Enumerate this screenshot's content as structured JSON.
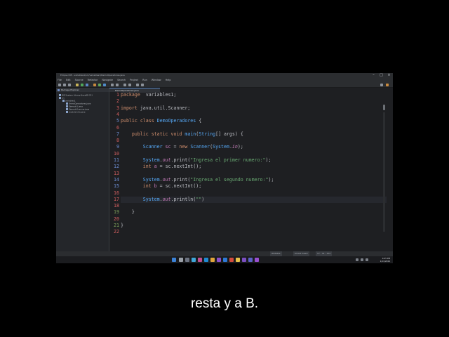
{
  "window": {
    "title": "Eclipse IDE - variables1/src/variables1/DemoOperadores.java",
    "menu": [
      "File",
      "Edit",
      "Source",
      "Refactor",
      "Navigate",
      "Search",
      "Project",
      "Run",
      "Window",
      "Help"
    ]
  },
  "explorer": {
    "tab_label": "Package Explorer",
    "items": [
      "JRE System Library [JavaSE-21]",
      "src",
      "variables1",
      "DemoOperadores.java",
      "Ejemplo1.java",
      "EjemploScanner.java",
      "module-info.java"
    ]
  },
  "editor": {
    "tab_label": "DemoOperadores.java",
    "lines": [
      {
        "n": "1",
        "tokens": [
          [
            "kw",
            "package"
          ],
          [
            "",
            "  variables1;"
          ]
        ]
      },
      {
        "n": "2",
        "tokens": []
      },
      {
        "n": "3",
        "tokens": [
          [
            "kw",
            "import"
          ],
          [
            "",
            " java.util.Scanner;"
          ]
        ]
      },
      {
        "n": "4",
        "tokens": []
      },
      {
        "n": "5",
        "tokens": [
          [
            "kw",
            "public"
          ],
          [
            "",
            " "
          ],
          [
            "kw",
            "class"
          ],
          [
            "",
            " "
          ],
          [
            "cls",
            "DemoOperadores"
          ],
          [
            "",
            " {"
          ]
        ]
      },
      {
        "n": "6",
        "tokens": []
      },
      {
        "n": "7",
        "tokens": [
          [
            "",
            "    "
          ],
          [
            "kw",
            "public"
          ],
          [
            "",
            " "
          ],
          [
            "kw",
            "static"
          ],
          [
            "",
            " "
          ],
          [
            "kw",
            "void"
          ],
          [
            "",
            " "
          ],
          [
            "cls",
            "main"
          ],
          [
            "",
            "("
          ],
          [
            "cls",
            "String"
          ],
          [
            "",
            "[] args) {"
          ]
        ]
      },
      {
        "n": "8",
        "tokens": []
      },
      {
        "n": "9",
        "tokens": [
          [
            "",
            "        "
          ],
          [
            "cls",
            "Scanner"
          ],
          [
            "",
            " "
          ],
          [
            "ty",
            "sc"
          ],
          [
            "",
            " = "
          ],
          [
            "kw",
            "new"
          ],
          [
            "",
            " "
          ],
          [
            "cls",
            "Scanner"
          ],
          [
            "",
            "("
          ],
          [
            "cls",
            "System"
          ],
          [
            "",
            "."
          ],
          [
            "fld",
            "in"
          ],
          [
            "",
            ");"
          ]
        ]
      },
      {
        "n": "10",
        "tokens": []
      },
      {
        "n": "11",
        "tokens": [
          [
            "",
            "        "
          ],
          [
            "cls",
            "System"
          ],
          [
            "",
            "."
          ],
          [
            "fld",
            "out"
          ],
          [
            "",
            ".print("
          ],
          [
            "st",
            "\"Ingresa el primer numero:\""
          ],
          [
            "",
            ");"
          ]
        ]
      },
      {
        "n": "12",
        "tokens": [
          [
            "",
            "        "
          ],
          [
            "kw",
            "int"
          ],
          [
            "",
            " "
          ],
          [
            "ty",
            "a"
          ],
          [
            "",
            " = sc.nextInt();"
          ]
        ]
      },
      {
        "n": "13",
        "tokens": []
      },
      {
        "n": "14",
        "tokens": [
          [
            "",
            "        "
          ],
          [
            "cls",
            "System"
          ],
          [
            "",
            "."
          ],
          [
            "fld",
            "out"
          ],
          [
            "",
            ".print("
          ],
          [
            "st",
            "\"Ingresa el segundo numero:\""
          ],
          [
            "",
            ");"
          ]
        ]
      },
      {
        "n": "15",
        "tokens": [
          [
            "",
            "        "
          ],
          [
            "kw",
            "int"
          ],
          [
            "",
            " "
          ],
          [
            "ty",
            "b"
          ],
          [
            "",
            " = sc.nextInt();"
          ]
        ]
      },
      {
        "n": "16",
        "tokens": []
      },
      {
        "n": "17",
        "tokens": [
          [
            "",
            "        "
          ],
          [
            "cls",
            "System"
          ],
          [
            "",
            "."
          ],
          [
            "fld",
            "out"
          ],
          [
            "",
            ".println("
          ],
          [
            "st",
            "\"\""
          ],
          [
            "",
            ")"
          ]
        ]
      },
      {
        "n": "18",
        "tokens": []
      },
      {
        "n": "19",
        "tokens": [
          [
            "",
            "    }"
          ]
        ]
      },
      {
        "n": "20",
        "tokens": []
      },
      {
        "n": "21",
        "tokens": [
          [
            "",
            "}"
          ]
        ]
      },
      {
        "n": "22",
        "tokens": []
      }
    ],
    "current_line": "17"
  },
  "status": {
    "writable": "Writable",
    "insert_mode": "Smart Insert",
    "position": "17 : 31 : 372"
  },
  "taskbar": {
    "time": "4:05 PM",
    "date": "1/11/2024"
  },
  "subtitle": "resta y a B.",
  "colors": {
    "keyword": "#cf8e6d",
    "class": "#56a8f5",
    "string": "#6aab73",
    "field": "#c77dbb"
  }
}
